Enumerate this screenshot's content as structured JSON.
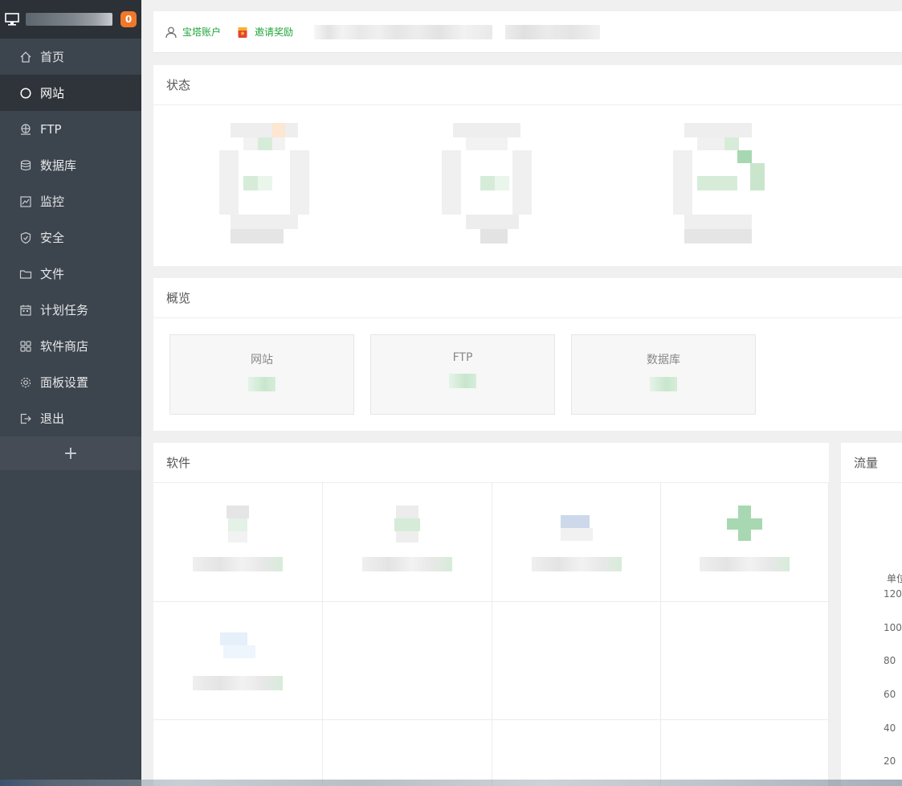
{
  "sidebar": {
    "badge": "0",
    "items": [
      {
        "label": "首页",
        "icon": "home-icon",
        "active": false
      },
      {
        "label": "网站",
        "icon": "globe-icon",
        "active": true
      },
      {
        "label": "FTP",
        "icon": "ftp-icon",
        "active": false
      },
      {
        "label": "数据库",
        "icon": "database-icon",
        "active": false
      },
      {
        "label": "监控",
        "icon": "monitor-chart-icon",
        "active": false
      },
      {
        "label": "安全",
        "icon": "shield-icon",
        "active": false
      },
      {
        "label": "文件",
        "icon": "folder-icon",
        "active": false
      },
      {
        "label": "计划任务",
        "icon": "calendar-icon",
        "active": false
      },
      {
        "label": "软件商店",
        "icon": "grid-icon",
        "active": false
      },
      {
        "label": "面板设置",
        "icon": "gear-icon",
        "active": false
      },
      {
        "label": "退出",
        "icon": "logout-icon",
        "active": false
      }
    ],
    "add_label": "+"
  },
  "topbar": {
    "account_label": "宝塔账户",
    "invite_label": "邀请奖励"
  },
  "status": {
    "title": "状态"
  },
  "overview": {
    "title": "概览",
    "cards": [
      {
        "label": "网站"
      },
      {
        "label": "FTP"
      },
      {
        "label": "数据库"
      }
    ]
  },
  "software": {
    "title": "软件"
  },
  "traffic": {
    "title": "流量",
    "unit_label": "单位",
    "ticks": [
      "120",
      "100",
      "80",
      "60",
      "40",
      "20"
    ]
  },
  "colors": {
    "sidebar_bg": "#3c444d",
    "sidebar_active": "#2e343a",
    "accent_green": "#20a53a",
    "badge_orange": "#f0782a"
  }
}
